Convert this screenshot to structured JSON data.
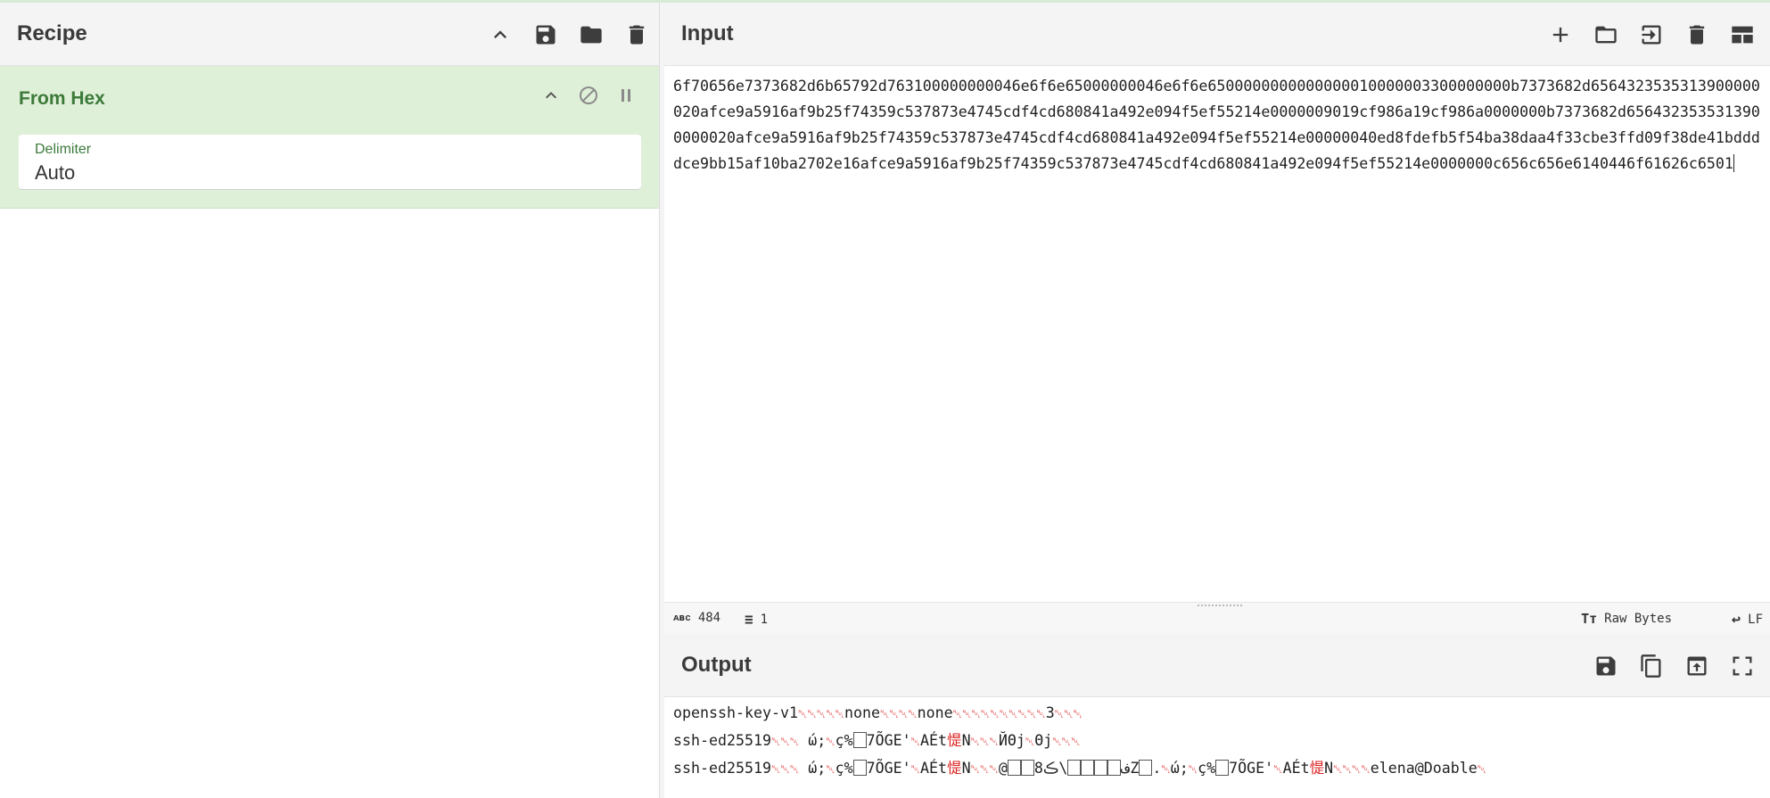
{
  "recipe": {
    "title": "Recipe",
    "operation": {
      "name": "From Hex",
      "delimiter_label": "Delimiter",
      "delimiter_value": "Auto"
    }
  },
  "input": {
    "title": "Input",
    "text": "6f70656e7373682d6b65792d763100000000046e6f6e65000000046e6f6e6500000000000000010000003300000000b7373682d6564323535313900000020afce9a5916af9b25f74359c537873e4745cdf4cd680841a492e094f5ef55214e0000009019cf986a19cf986a0000000b7373682d6564323535313900000020afce9a5916af9b25f74359c537873e4745cdf4cd680841a492e094f5ef55214e00000040ed8fdefb5f54ba38daa4f33cbe3ffd09f38de41bddddce9bb15af10ba2702e16afce9a5916af9b25f74359c537873e4745cdf4cd680841a492e094f5ef55214e0000000c656c656e6140446f61626c6501",
    "status": {
      "char_count": "484",
      "line_count": "1",
      "encoding": "Raw Bytes",
      "eol": "LF"
    }
  },
  "output": {
    "title": "Output",
    "lines": [
      "openssh-key-v1␀␀␀␀␀none␀␀␀␀none␀␀␀␀␀␀␀␀␀␀3␀␀␀",
      "ssh-ed25519␀␀␀ ώ;␀ç%⍰7ÕGE'␀AÉt惿N␀␀␀ЙΘj␀Θj␀␀␀",
      "ssh-ed25519␀␀␀ ώ;␀ç%⍰7ÕGE'␀AÉt惿N␀␀␀@⍰⍰8ف⍰⍰⍰⍰\\ڪZ⍰.␀ώ;␀ç%⍰7ÕGE'␀AÉt惿N␀␀␀␀elena@Doable␀"
    ]
  },
  "icons": {
    "recipe": [
      "chevron-up-icon",
      "save-icon",
      "folder-icon",
      "trash-icon"
    ],
    "input": [
      "plus-icon",
      "folder-icon",
      "import-icon",
      "trash-icon",
      "layout-icon"
    ],
    "output": [
      "save-icon",
      "copy-icon",
      "export-icon",
      "fullscreen-icon"
    ]
  }
}
